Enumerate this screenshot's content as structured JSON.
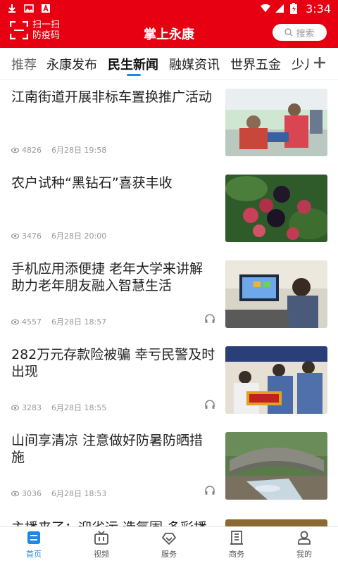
{
  "status_bar": {
    "time": "3:34"
  },
  "header": {
    "scan_label": "扫一扫\n防疫码",
    "title": "掌上永康",
    "search_placeholder": "搜索"
  },
  "tabs": [
    {
      "label": "推荐"
    },
    {
      "label": "永康发布"
    },
    {
      "label": "民生新闻"
    },
    {
      "label": "融媒资讯"
    },
    {
      "label": "世界五金"
    },
    {
      "label": "少儿"
    }
  ],
  "articles": [
    {
      "title": "江南街道开展非标车置换推广活动",
      "views": "4826",
      "date": "6月28日 19:58",
      "has_audio": false,
      "image": "people-demonstration"
    },
    {
      "title": "农户试种“黑钻石”喜获丰收",
      "views": "3476",
      "date": "6月28日 20:00",
      "has_audio": false,
      "image": "blackberries"
    },
    {
      "title": "手机应用添便捷 老年大学来讲解助力老年朋友融入智慧生活",
      "views": "4557",
      "date": "6月28日 18:57",
      "has_audio": true,
      "image": "tablet-lesson"
    },
    {
      "title": "282万元存款险被骗 幸亏民警及时出现",
      "views": "3283",
      "date": "6月28日 18:55",
      "has_audio": true,
      "image": "police-award"
    },
    {
      "title": "山间享清凉 注意做好防暑防晒措施",
      "views": "3036",
      "date": "6月28日 18:53",
      "has_audio": true,
      "image": "stone-bridge"
    }
  ],
  "partial_article": {
    "title": "主播来了：迎省运 造氛围 多彩播"
  },
  "bottom_nav": [
    {
      "label": "首页",
      "icon": "home-icon"
    },
    {
      "label": "视频",
      "icon": "tv-icon"
    },
    {
      "label": "服务",
      "icon": "service-icon"
    },
    {
      "label": "商务",
      "icon": "building-icon"
    },
    {
      "label": "我的",
      "icon": "user-icon"
    }
  ],
  "colors": {
    "brand_red": "#e60012",
    "active_blue": "#1e88e5"
  }
}
